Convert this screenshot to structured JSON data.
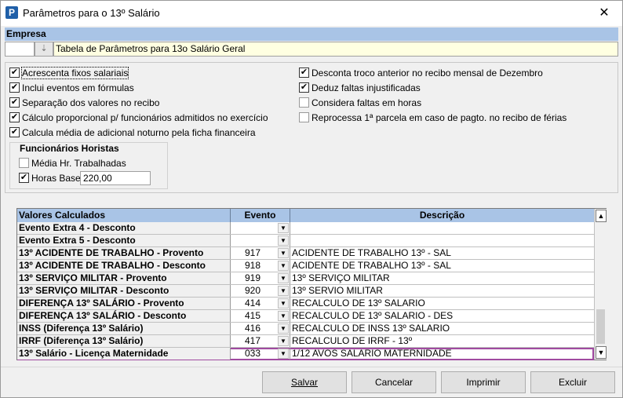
{
  "window": {
    "title": "Parâmetros para o 13º Salário",
    "icon_letter": "P",
    "close_glyph": "✕"
  },
  "empresa": {
    "header": "Empresa",
    "code": "",
    "button_glyph": "⇣",
    "name": "Tabela de Parâmetros para 13o Salário Geral"
  },
  "options_left": [
    {
      "label": "Acrescenta fixos salariais",
      "checked": true
    },
    {
      "label": "Inclui eventos em fórmulas",
      "checked": true
    },
    {
      "label": "Separação dos valores no recibo",
      "checked": true
    },
    {
      "label": "Cálculo proporcional p/ funcionários admitidos no exercício",
      "checked": true
    },
    {
      "label": "Calcula média de adicional noturno pela ficha financeira",
      "checked": true
    }
  ],
  "options_right": [
    {
      "label": "Desconta troco anterior no recibo mensal de Dezembro",
      "checked": true
    },
    {
      "label": "Deduz faltas injustificadas",
      "checked": true
    },
    {
      "label": "Considera faltas em horas",
      "checked": false
    },
    {
      "label": "Reprocessa 1ª parcela em caso de pagto. no recibo de férias",
      "checked": false
    }
  ],
  "horistas": {
    "title": "Funcionários Horistas",
    "media_label": "Média Hr. Trabalhadas",
    "media_checked": false,
    "horas_base_label": "Horas Base",
    "horas_base_checked": true,
    "horas_base_value": "220,00"
  },
  "grid": {
    "headers": {
      "valores": "Valores Calculados",
      "evento": "Evento",
      "descricao": "Descrição"
    },
    "rows": [
      {
        "name": "Evento Extra 4 - Desconto",
        "evento": "",
        "descricao": ""
      },
      {
        "name": "Evento Extra 5 - Desconto",
        "evento": "",
        "descricao": ""
      },
      {
        "name": "13º ACIDENTE DE TRABALHO - Provento",
        "evento": "917",
        "descricao": "ACIDENTE DE TRABALHO 13º - SAL"
      },
      {
        "name": "13º ACIDENTE DE TRABALHO - Desconto",
        "evento": "918",
        "descricao": "ACIDENTE DE TRABALHO 13º - SAL"
      },
      {
        "name": "13º SERVIÇO MILITAR - Provento",
        "evento": "919",
        "descricao": "13º SERVIÇO MILITAR"
      },
      {
        "name": "13º SERVIÇO MILITAR - Desconto",
        "evento": "920",
        "descricao": "13º SERVIO MILITAR"
      },
      {
        "name": "DIFERENÇA 13º SALÁRIO - Provento",
        "evento": "414",
        "descricao": "RECALCULO DE 13º SALARIO"
      },
      {
        "name": "DIFERENÇA 13º SALÁRIO - Desconto",
        "evento": "415",
        "descricao": "RECALCULO DE 13º SALARIO - DES"
      },
      {
        "name": "INSS (Diferença 13º Salário)",
        "evento": "416",
        "descricao": "RECALCULO DE INSS 13º SALARIO"
      },
      {
        "name": "IRRF (Diferença 13º Salário)",
        "evento": "417",
        "descricao": "RECALCULO DE IRRF - 13º"
      },
      {
        "name": "13º Salário - Licença Maternidade",
        "evento": "033",
        "descricao": "1/12 AVOS SALARIO MATERNIDADE"
      }
    ],
    "selected_index": 10
  },
  "buttons": {
    "salvar": "Salvar",
    "cancelar": "Cancelar",
    "imprimir": "Imprimir",
    "excluir": "Excluir"
  }
}
